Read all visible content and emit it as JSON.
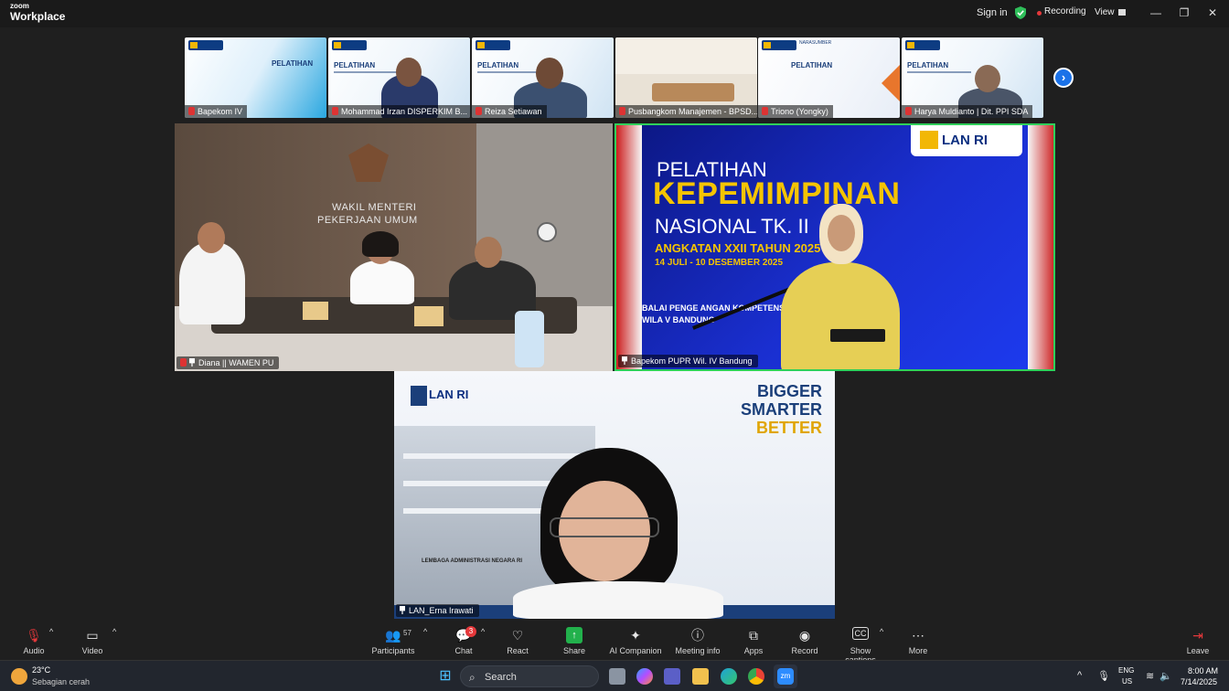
{
  "titlebar": {
    "brand_top": "zoom",
    "brand_bottom": "Workplace",
    "sign_in": "Sign in",
    "recording": "Recording",
    "view": "View",
    "minimize": "—",
    "restore": "❐",
    "close": "✕"
  },
  "filmstrip": [
    {
      "name": "Bapekom IV",
      "slide_title": "PELATIHAN"
    },
    {
      "name": "Mohammad Irzan DISPERKIM B...",
      "slide_title": "PELATIHAN"
    },
    {
      "name": "Reiza Setiawan",
      "slide_title": "PELATIHAN"
    },
    {
      "name": "Pusbangkom Manajemen - BPSD..."
    },
    {
      "name": "Triono (Yongky)",
      "slide_title": "PELATIHAN",
      "tag": "NARASUMBER"
    },
    {
      "name": "Harya Muldianto | Dit. PPI SDA",
      "slide_title": "PELATIHAN"
    }
  ],
  "tiles": {
    "diana": {
      "name": "Diana || WAMEN PU",
      "wall_line1": "WAKIL MENTERI",
      "wall_line2": "PEKERJAAN UMUM"
    },
    "bapekom": {
      "name": "Bapekom PUPR Wil. IV Bandung",
      "logo": "LAN RI",
      "line1": "PELATIHAN",
      "line2": "KEPEMIMPINAN",
      "line3": "NASIONAL TK. II",
      "line4": "ANGKATAN XXII TAHUN 2025",
      "line5": "14 JULI - 10 DESEMBER 2025",
      "line6": "BALAI PENGE  ANGAN KOMPETENSI PU",
      "line7": "WILA    V BANDUNG"
    },
    "erna": {
      "name": "LAN_Erna Irawati",
      "logo": "LAN RI",
      "tag1": "BIGGER",
      "tag2": "SMARTER",
      "tag3": "BETTER",
      "building_sign": "LEMBAGA ADMINISTRASI NEGARA RI"
    }
  },
  "toolbar": {
    "audio": "Audio",
    "video": "Video",
    "participants": "Participants",
    "participants_count": "57",
    "chat": "Chat",
    "chat_badge": "3",
    "react": "React",
    "share": "Share",
    "ai_companion": "AI Companion",
    "meeting_info": "Meeting info",
    "apps": "Apps",
    "record": "Record",
    "show_captions": "Show captions",
    "more": "More",
    "leave": "Leave"
  },
  "taskbar": {
    "temp": "23°C",
    "weather": "Sebagian cerah",
    "search": "Search",
    "lang": "ENG",
    "region": "US",
    "time": "8:00 AM",
    "date": "7/14/2025"
  },
  "colors": {
    "accent_blue": "#1b72e8",
    "active_speaker": "#2fd05a",
    "share_green": "#22b14c",
    "record_red": "#e5383b"
  }
}
